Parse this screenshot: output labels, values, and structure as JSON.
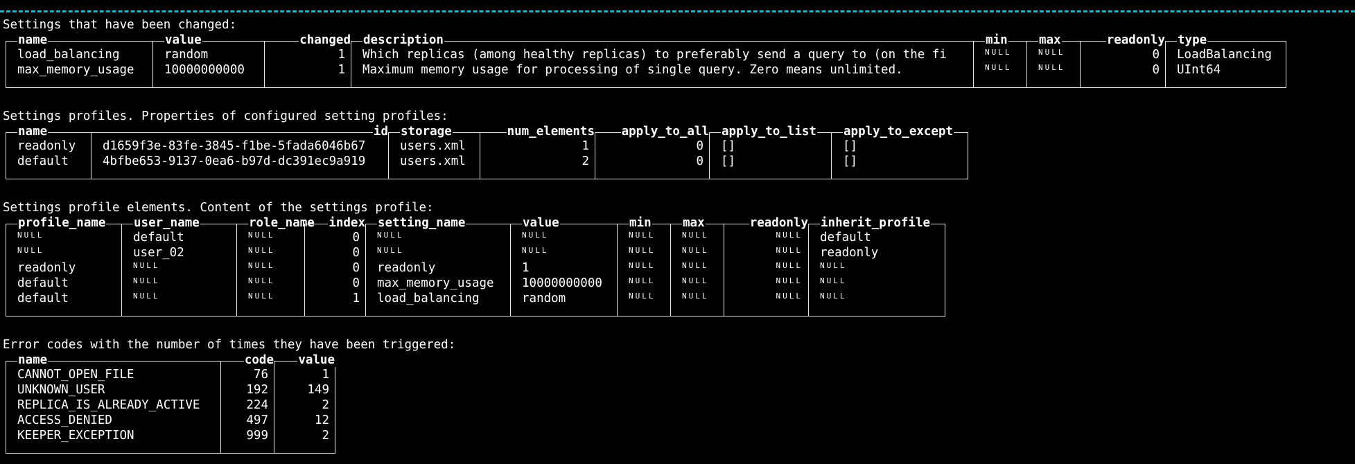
{
  "null_text": "NULL",
  "colors": {
    "background": "#000000",
    "text": "#ffffff",
    "rule": "#2ab3c6",
    "border": "#e6e6e6"
  },
  "sections": [
    {
      "title": "Settings that have been changed:",
      "columns": [
        "name",
        "value",
        "changed",
        "description",
        "min",
        "max",
        "readonly",
        "type"
      ],
      "rows": [
        [
          "load_balancing",
          "random",
          "1",
          "Which replicas (among healthy replicas) to preferably send a query to (on the fi",
          "NULL",
          "NULL",
          "0",
          "LoadBalancing"
        ],
        [
          "max_memory_usage",
          "10000000000",
          "1",
          "Maximum memory usage for processing of single query. Zero means unlimited.",
          "NULL",
          "NULL",
          "0",
          "UInt64"
        ]
      ]
    },
    {
      "title": "Settings profiles. Properties of configured setting profiles:",
      "columns": [
        "name",
        "id",
        "storage",
        "num_elements",
        "apply_to_all",
        "apply_to_list",
        "apply_to_except"
      ],
      "rows": [
        [
          "readonly",
          "d1659f3e-83fe-3845-f1be-5fada6046b67",
          "users.xml",
          "1",
          "0",
          "[]",
          "[]"
        ],
        [
          "default",
          "4bfbe653-9137-0ea6-b97d-dc391ec9a919",
          "users.xml",
          "2",
          "0",
          "[]",
          "[]"
        ]
      ]
    },
    {
      "title": "Settings profile elements. Content of the settings profile:",
      "columns": [
        "profile_name",
        "user_name",
        "role_name",
        "index",
        "setting_name",
        "value",
        "min",
        "max",
        "readonly",
        "inherit_profile"
      ],
      "rows": [
        [
          "NULL",
          "default",
          "NULL",
          "0",
          "NULL",
          "NULL",
          "NULL",
          "NULL",
          "NULL",
          "default"
        ],
        [
          "NULL",
          "user_02",
          "NULL",
          "0",
          "NULL",
          "NULL",
          "NULL",
          "NULL",
          "NULL",
          "readonly"
        ],
        [
          "readonly",
          "NULL",
          "NULL",
          "0",
          "readonly",
          "1",
          "NULL",
          "NULL",
          "NULL",
          "NULL"
        ],
        [
          "default",
          "NULL",
          "NULL",
          "0",
          "max_memory_usage",
          "10000000000",
          "NULL",
          "NULL",
          "NULL",
          "NULL"
        ],
        [
          "default",
          "NULL",
          "NULL",
          "1",
          "load_balancing",
          "random",
          "NULL",
          "NULL",
          "NULL",
          "NULL"
        ]
      ]
    },
    {
      "title": "Error codes with the number of times they have been triggered:",
      "columns": [
        "name",
        "code",
        "value"
      ],
      "rows": [
        [
          "CANNOT_OPEN_FILE",
          "76",
          "1"
        ],
        [
          "UNKNOWN_USER",
          "192",
          "149"
        ],
        [
          "REPLICA_IS_ALREADY_ACTIVE",
          "224",
          "2"
        ],
        [
          "ACCESS_DENIED",
          "497",
          "12"
        ],
        [
          "KEEPER_EXCEPTION",
          "999",
          "2"
        ]
      ]
    }
  ]
}
